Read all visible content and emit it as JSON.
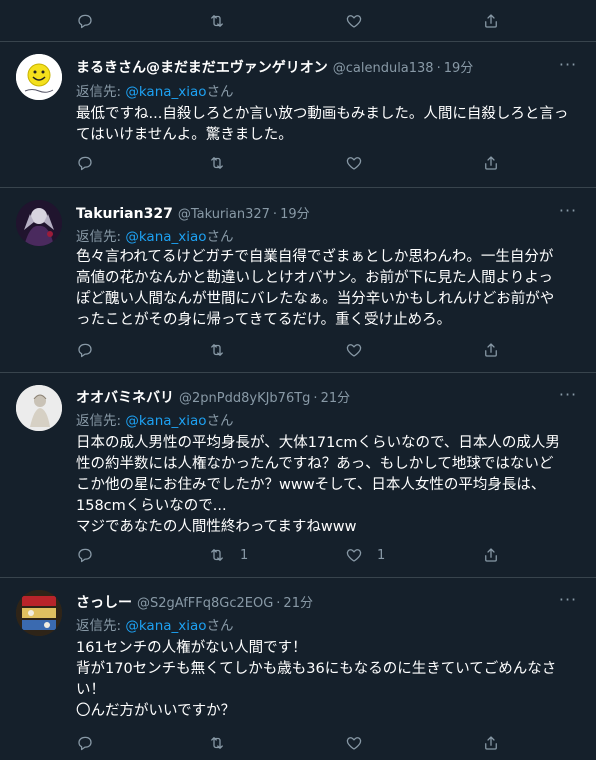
{
  "top_actions": {
    "reply_count": "",
    "retweet_count": "",
    "like_count": ""
  },
  "tweets": [
    {
      "display_name": "まるきさん@まだまだエヴァンゲリオン",
      "handle": "@calendula138",
      "separator": "·",
      "time": "19分",
      "replying_prefix": "返信先: ",
      "replying_mention": "@kana_xiao",
      "replying_suffix": "さん",
      "text_lines": [
        "最低ですね...自殺しろとか言い放つ動画もみました。人間に自殺しろと言っ",
        "てはいけませんよ。驚きました。"
      ],
      "reply_count": "",
      "retweet_count": "",
      "like_count": ""
    },
    {
      "display_name": "Takurian327",
      "handle": "@Takurian327",
      "separator": "·",
      "time": "19分",
      "replying_prefix": "返信先: ",
      "replying_mention": "@kana_xiao",
      "replying_suffix": "さん",
      "text_lines": [
        "色々言われてるけどガチで自業自得でざまぁとしか思わんわ。一生自分が",
        "高値の花かなんかと勘違いしとけオバサン。お前が下に見た人間よりよっ",
        "ぽど醜い人間なんが世間にバレたなぁ。当分辛いかもしれんけどお前がや",
        "ったことがその身に帰ってきてるだけ。重く受け止めろ。"
      ],
      "reply_count": "",
      "retweet_count": "",
      "like_count": ""
    },
    {
      "display_name": "オオバミネバリ",
      "handle": "@2pnPdd8yKJb76Tg",
      "separator": "·",
      "time": "21分",
      "replying_prefix": "返信先: ",
      "replying_mention": "@kana_xiao",
      "replying_suffix": "さん",
      "text_lines": [
        "日本の成人男性の平均身長が、大体171cmくらいなので、日本人の成人男",
        "性の約半数には人権なかったんですね？あっ、もしかして地球ではないど",
        "こか他の星にお住みでしたか？wwwそして、日本人女性の平均身長は、",
        "158cmくらいなので...",
        "マジであなたの人間性終わってますねwww"
      ],
      "reply_count": "",
      "retweet_count": "1",
      "like_count": "1"
    },
    {
      "display_name": "さっしー",
      "handle": "@S2gAfFFq8Gc2EOG",
      "separator": "·",
      "time": "21分",
      "replying_prefix": "返信先: ",
      "replying_mention": "@kana_xiao",
      "replying_suffix": "さん",
      "text_lines": [
        "161センチの人権がない人間です！",
        "背が170センチも無くてしかも歳も36にもなるのに生きていてごめんなさ",
        "い！",
        "〇んだ方がいいですか？"
      ],
      "reply_count": "",
      "retweet_count": "",
      "like_count": ""
    }
  ],
  "icons": {
    "reply": "reply-icon",
    "retweet": "retweet-icon",
    "like": "like-icon",
    "share": "share-icon",
    "more": "more-icon"
  },
  "colors": {
    "background": "#15202b",
    "border": "#38444d",
    "secondary": "#8899a6",
    "link": "#1da1f2",
    "text": "#ffffff"
  },
  "more_glyph": "···"
}
